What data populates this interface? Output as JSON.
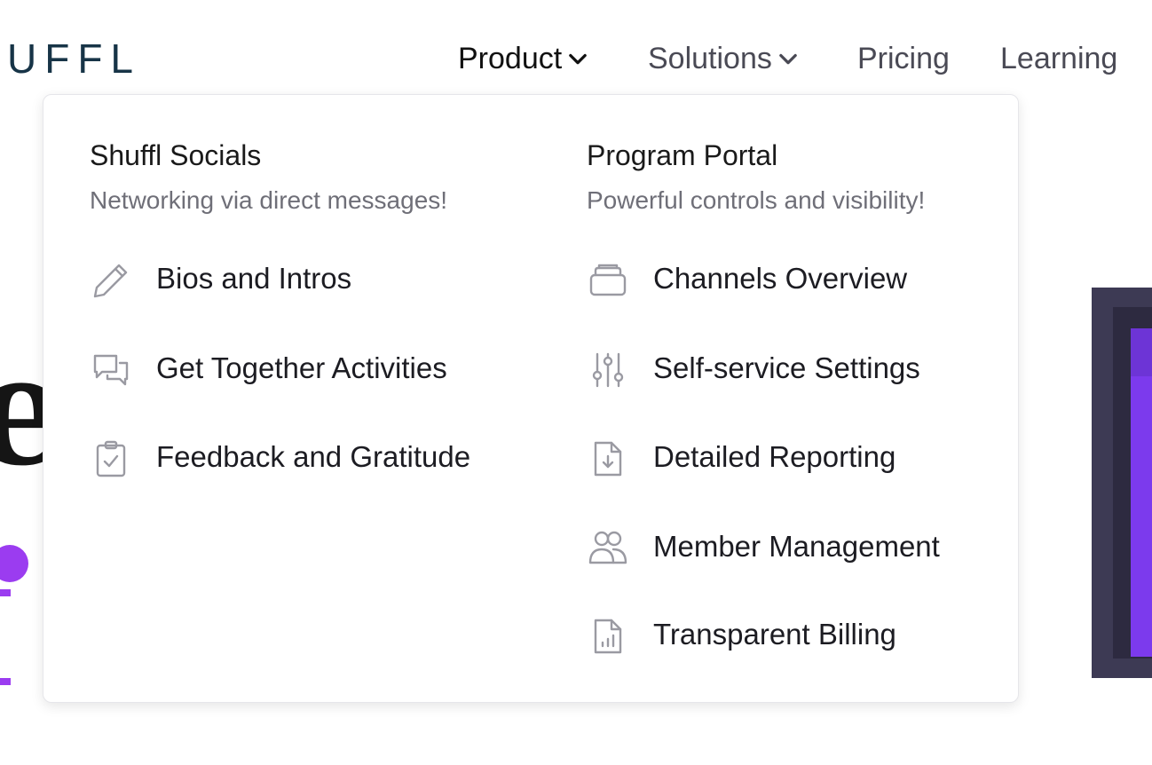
{
  "header": {
    "logo_text": "UFFL",
    "nav": [
      {
        "label": "Product",
        "has_dropdown": true,
        "active": true
      },
      {
        "label": "Solutions",
        "has_dropdown": true,
        "active": false
      },
      {
        "label": "Pricing",
        "has_dropdown": false,
        "active": false
      },
      {
        "label": "Learning",
        "has_dropdown": false,
        "active": false
      }
    ]
  },
  "dropdown": {
    "columns": [
      {
        "title": "Shuffl Socials",
        "subtitle": "Networking via direct messages!",
        "items": [
          {
            "label": "Bios and Intros",
            "icon": "pencil-icon"
          },
          {
            "label": "Get Together Activities",
            "icon": "chat-bubbles-icon"
          },
          {
            "label": "Feedback and Gratitude",
            "icon": "clipboard-check-icon"
          }
        ]
      },
      {
        "title": "Program Portal",
        "subtitle": "Powerful controls and visibility!",
        "items": [
          {
            "label": "Channels Overview",
            "icon": "inbox-stack-icon"
          },
          {
            "label": "Self-service Settings",
            "icon": "sliders-icon"
          },
          {
            "label": "Detailed Reporting",
            "icon": "document-download-icon"
          },
          {
            "label": "Member Management",
            "icon": "users-icon"
          },
          {
            "label": "Transparent Billing",
            "icon": "document-chart-icon"
          }
        ]
      }
    ]
  },
  "colors": {
    "logo": "#173447",
    "accent_purple": "#9b3cf0",
    "icon_gray": "#9a9aa2",
    "subtitle_gray": "#6f6f78"
  }
}
